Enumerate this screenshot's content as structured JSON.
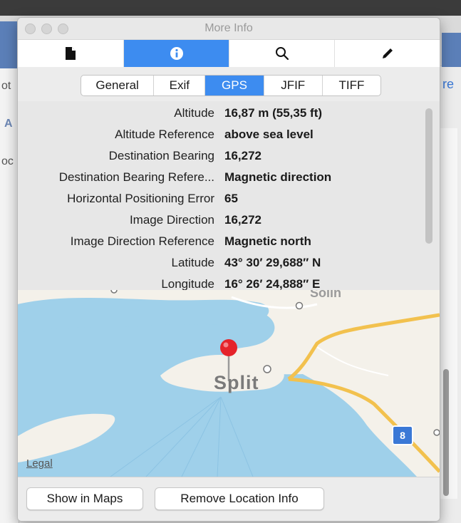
{
  "window": {
    "title": "More Info"
  },
  "toolbar": {
    "tabs": [
      {
        "name": "document-icon"
      },
      {
        "name": "info-icon",
        "active": true
      },
      {
        "name": "search-icon"
      },
      {
        "name": "pencil-icon"
      }
    ]
  },
  "segments": {
    "items": [
      "General",
      "Exif",
      "GPS",
      "JFIF",
      "TIFF"
    ],
    "selected": "GPS"
  },
  "gps": {
    "rows": [
      {
        "key": "Altitude",
        "value": "16,87 m (55,35 ft)"
      },
      {
        "key": "Altitude Reference",
        "value": "above sea level"
      },
      {
        "key": "Destination Bearing",
        "value": "16,272"
      },
      {
        "key": "Destination Bearing Refere...",
        "value": "Magnetic direction"
      },
      {
        "key": "Horizontal Positioning Error",
        "value": "65"
      },
      {
        "key": "Image Direction",
        "value": "16,272"
      },
      {
        "key": "Image Direction Reference",
        "value": "Magnetic north"
      },
      {
        "key": "Latitude",
        "value": "43° 30′ 29,688″ N"
      },
      {
        "key": "Longitude",
        "value": "16° 26′ 24,888″ E"
      }
    ]
  },
  "map": {
    "legal": "Legal",
    "city": "Split",
    "city_top": "Solin",
    "road_shield": "8"
  },
  "footer": {
    "show_in_maps": "Show in Maps",
    "remove_location": "Remove Location Info"
  },
  "background": {
    "left_labels": [
      "ot",
      "A",
      "oc"
    ],
    "right_link": "re"
  },
  "colors": {
    "accent": "#3d8cf0",
    "pin": "#e5232b",
    "water": "#9fd0ea",
    "road": "#f2c14e"
  }
}
